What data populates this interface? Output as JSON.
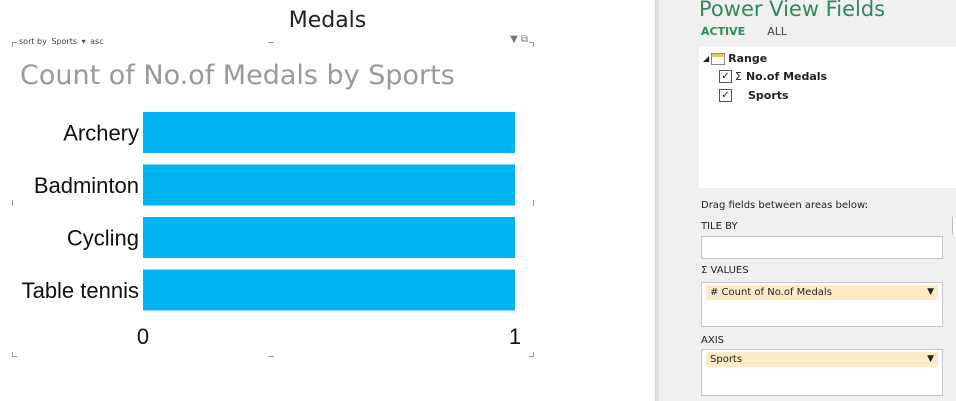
{
  "sheet": {
    "title": "Medals"
  },
  "visual": {
    "sort": {
      "prefix": "sort by",
      "field": "Sports",
      "dropdown": "▾",
      "order": "asc"
    },
    "filter_icon": "▼",
    "popout_icon": "⧉"
  },
  "chart_data": {
    "type": "bar",
    "orientation": "horizontal",
    "title": "Count of No.of Medals by Sports",
    "categories": [
      "Archery",
      "Badminton",
      "Cycling",
      "Table tennis"
    ],
    "values": [
      1,
      1,
      1,
      1
    ],
    "xlim": [
      0,
      1
    ],
    "xticks": [
      "0",
      "1"
    ],
    "grid": false,
    "legend": "none",
    "bar_color": "#00b4f0"
  },
  "field_pane": {
    "title": "Power View Fields",
    "tabs": [
      "ACTIVE",
      "ALL"
    ],
    "table": {
      "expander": "◢",
      "name": "Range"
    },
    "fields": [
      {
        "name": "No.of Medals",
        "checked": "✓",
        "sigma": "Σ"
      },
      {
        "name": "Sports",
        "checked": "✓",
        "sigma": ""
      }
    ],
    "areas_title": "Drag fields between areas below:",
    "tile_by": {
      "label": "TILE BY"
    },
    "values": {
      "label": "Σ VALUES",
      "field": "# Count of No.of Medals",
      "arrow": "▼"
    },
    "axis": {
      "label": "AXIS",
      "field": "Sports",
      "arrow": "▼"
    }
  },
  "colors": {
    "accent": "#2e8b57",
    "bar": "#00b4f0",
    "pill": "#fdebc8"
  }
}
